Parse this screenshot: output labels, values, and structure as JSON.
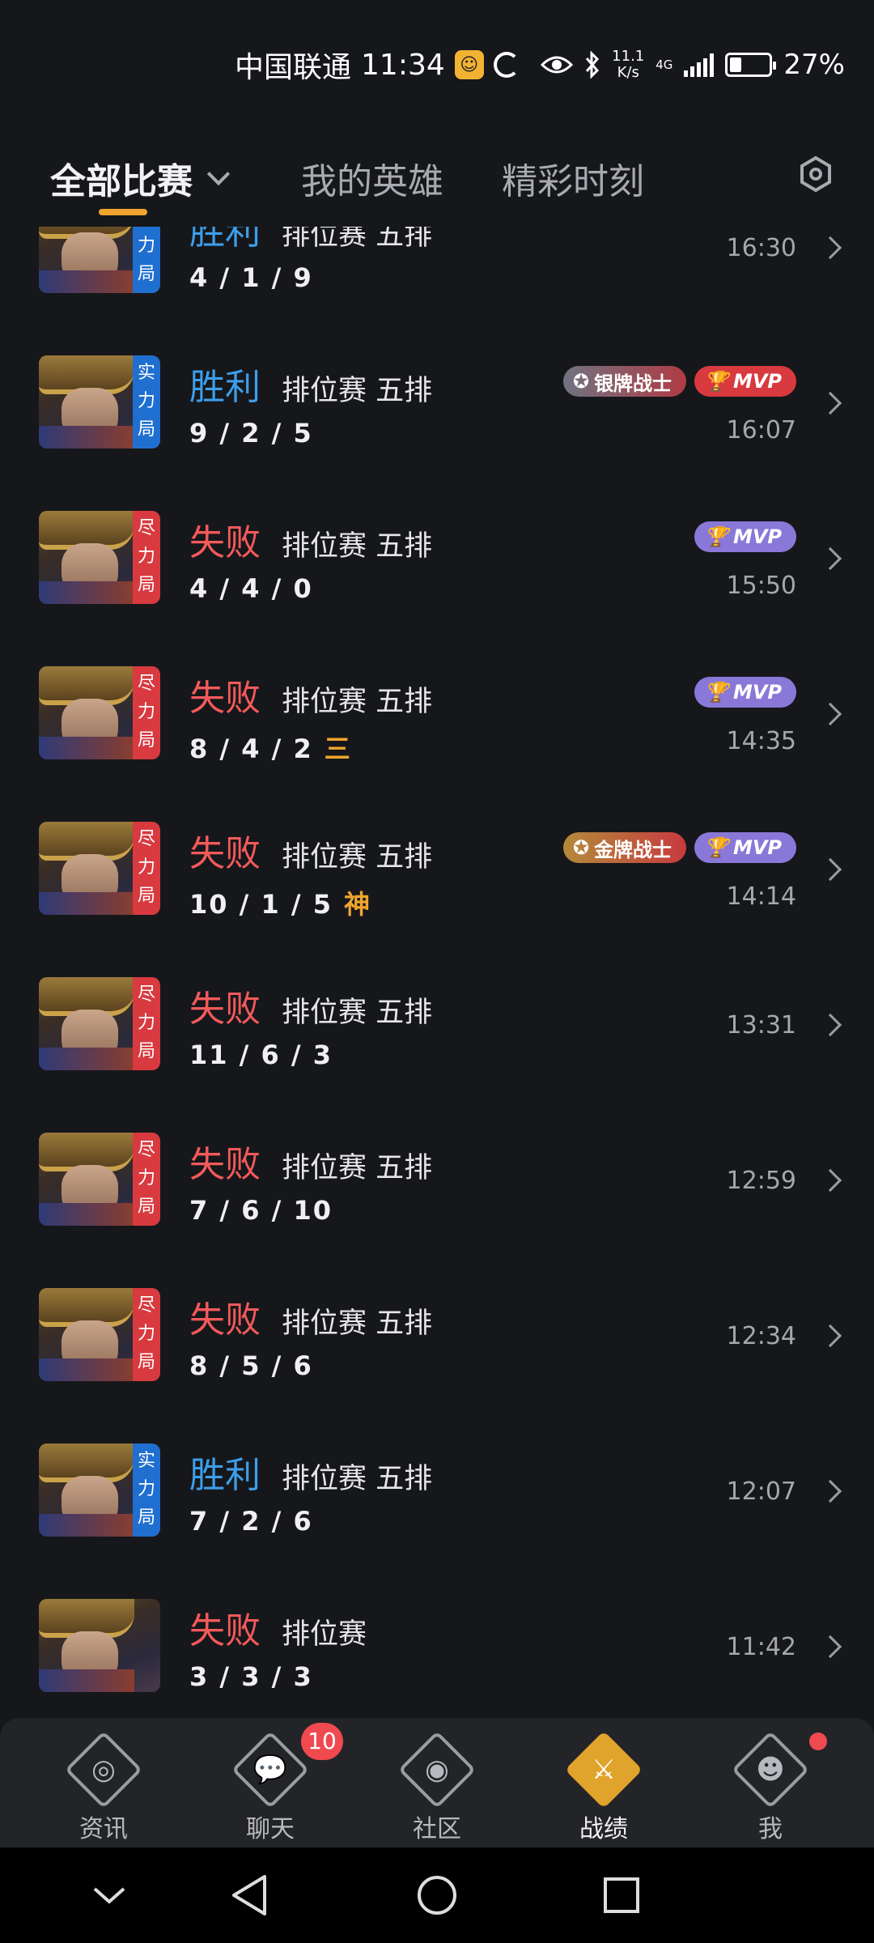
{
  "status_bar": {
    "carrier": "中国联通",
    "time": "11:34",
    "net_speed_value": "11.1",
    "net_speed_unit": "K/s",
    "network_type": "4G",
    "battery_percent": 27,
    "battery_label": "27%"
  },
  "tabs": {
    "all_matches": "全部比赛",
    "my_heroes": "我的英雄",
    "highlights": "精彩时刻"
  },
  "matches": [
    {
      "mode_badge": "实力局",
      "badge_color": "blue",
      "result": "胜利",
      "outcome": "win",
      "mode": "排位赛 五排",
      "kda": "4 / 1 / 9",
      "special": "",
      "badges": [],
      "time": "16:30"
    },
    {
      "mode_badge": "实力局",
      "badge_color": "blue",
      "result": "胜利",
      "outcome": "win",
      "mode": "排位赛 五排",
      "kda": "9 / 2 / 5",
      "special": "",
      "badges": [
        {
          "type": "silver",
          "label": "银牌战士"
        },
        {
          "type": "mvp-red",
          "label": "MVP"
        }
      ],
      "time": "16:07"
    },
    {
      "mode_badge": "尽力局",
      "badge_color": "red",
      "result": "失败",
      "outcome": "lose",
      "mode": "排位赛 五排",
      "kda": "4 / 4 / 0",
      "special": "",
      "badges": [
        {
          "type": "mvp-purple",
          "label": "MVP"
        }
      ],
      "time": "15:50"
    },
    {
      "mode_badge": "尽力局",
      "badge_color": "red",
      "result": "失败",
      "outcome": "lose",
      "mode": "排位赛 五排",
      "kda": "8 / 4 / 2",
      "special": "三",
      "badges": [
        {
          "type": "mvp-purple",
          "label": "MVP"
        }
      ],
      "time": "14:35"
    },
    {
      "mode_badge": "尽力局",
      "badge_color": "red",
      "result": "失败",
      "outcome": "lose",
      "mode": "排位赛 五排",
      "kda": "10 / 1 / 5",
      "special": "神",
      "badges": [
        {
          "type": "gold",
          "label": "金牌战士"
        },
        {
          "type": "mvp-purple",
          "label": "MVP"
        }
      ],
      "time": "14:14"
    },
    {
      "mode_badge": "尽力局",
      "badge_color": "red",
      "result": "失败",
      "outcome": "lose",
      "mode": "排位赛 五排",
      "kda": "11 / 6 / 3",
      "special": "",
      "badges": [],
      "time": "13:31"
    },
    {
      "mode_badge": "尽力局",
      "badge_color": "red",
      "result": "失败",
      "outcome": "lose",
      "mode": "排位赛 五排",
      "kda": "7 / 6 / 10",
      "special": "",
      "badges": [],
      "time": "12:59"
    },
    {
      "mode_badge": "尽力局",
      "badge_color": "red",
      "result": "失败",
      "outcome": "lose",
      "mode": "排位赛 五排",
      "kda": "8 / 5 / 6",
      "special": "",
      "badges": [],
      "time": "12:34"
    },
    {
      "mode_badge": "实力局",
      "badge_color": "blue",
      "result": "胜利",
      "outcome": "win",
      "mode": "排位赛 五排",
      "kda": "7 / 2 / 6",
      "special": "",
      "badges": [],
      "time": "12:07"
    },
    {
      "mode_badge": "",
      "badge_color": "",
      "result": "失败",
      "outcome": "lose",
      "mode": "排位赛",
      "kda": "3 / 3 / 3",
      "special": "",
      "badges": [],
      "time": "11:42"
    }
  ],
  "bottom_nav": [
    {
      "label": "资讯",
      "icon": "news-icon",
      "active": false
    },
    {
      "label": "聊天",
      "icon": "chat-icon",
      "active": false,
      "count": "10"
    },
    {
      "label": "社区",
      "icon": "community-icon",
      "active": false
    },
    {
      "label": "战绩",
      "icon": "crossed-swords-icon",
      "active": true
    },
    {
      "label": "我",
      "icon": "profile-icon",
      "active": false,
      "dot": true
    }
  ],
  "colors": {
    "win": "#3d9eea",
    "lose": "#f35a5a",
    "accent": "#f0a52e",
    "background": "#16171b"
  }
}
